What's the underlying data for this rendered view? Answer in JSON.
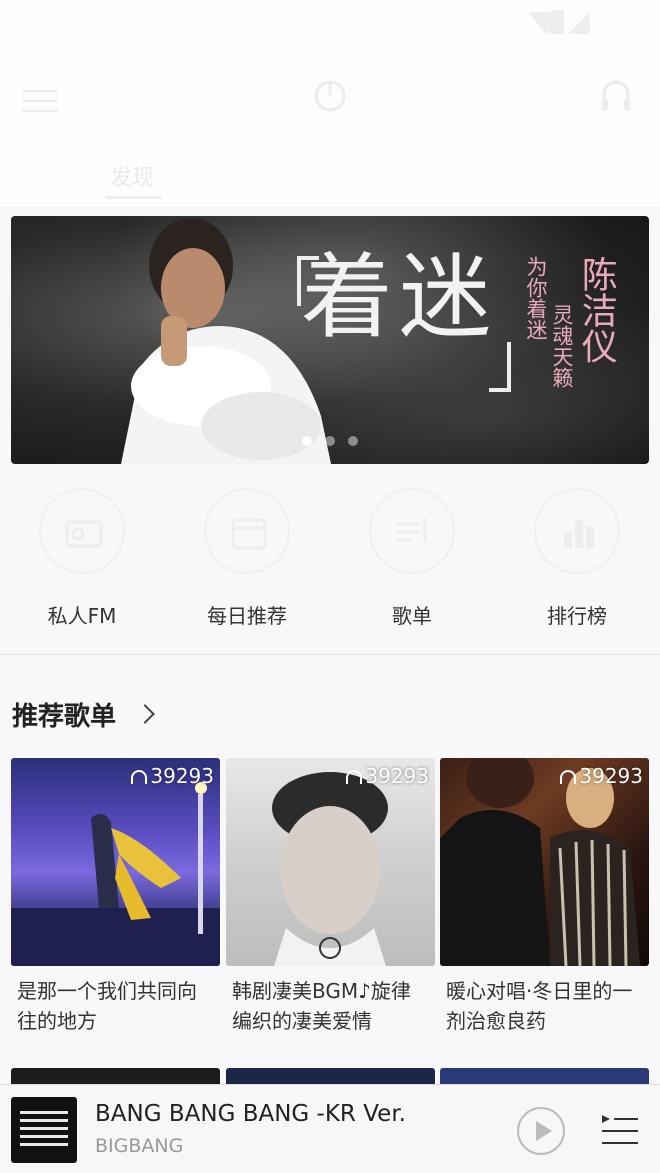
{
  "banner": {
    "headline": "着迷",
    "tagline_1": "为你着迷",
    "tagline_2": "灵魂天籁",
    "artist": "陈洁仪"
  },
  "nav": {
    "tab_discover": "发现"
  },
  "quick_actions": [
    {
      "label": "私人FM",
      "icon": "radio-icon"
    },
    {
      "label": "每日推荐",
      "icon": "calendar-icon"
    },
    {
      "label": "歌单",
      "icon": "playlist-icon"
    },
    {
      "label": "排行榜",
      "icon": "chart-icon"
    }
  ],
  "recommended": {
    "title": "推荐歌单",
    "playlists": [
      {
        "plays": "39293",
        "title": "是那一个我们共同向往的地方"
      },
      {
        "plays": "39293",
        "title": "韩剧凄美BGM♪旋律编织的凄美爱情"
      },
      {
        "plays": "39293",
        "title": "暖心对唱·冬日里的一剂治愈良药"
      }
    ]
  },
  "now_playing": {
    "title": "BANG BANG BANG -KR Ver.",
    "artist": "BIGBANG"
  },
  "colors": {
    "accent_pink": "#e8a9b8",
    "background": "#f8f8fa"
  }
}
